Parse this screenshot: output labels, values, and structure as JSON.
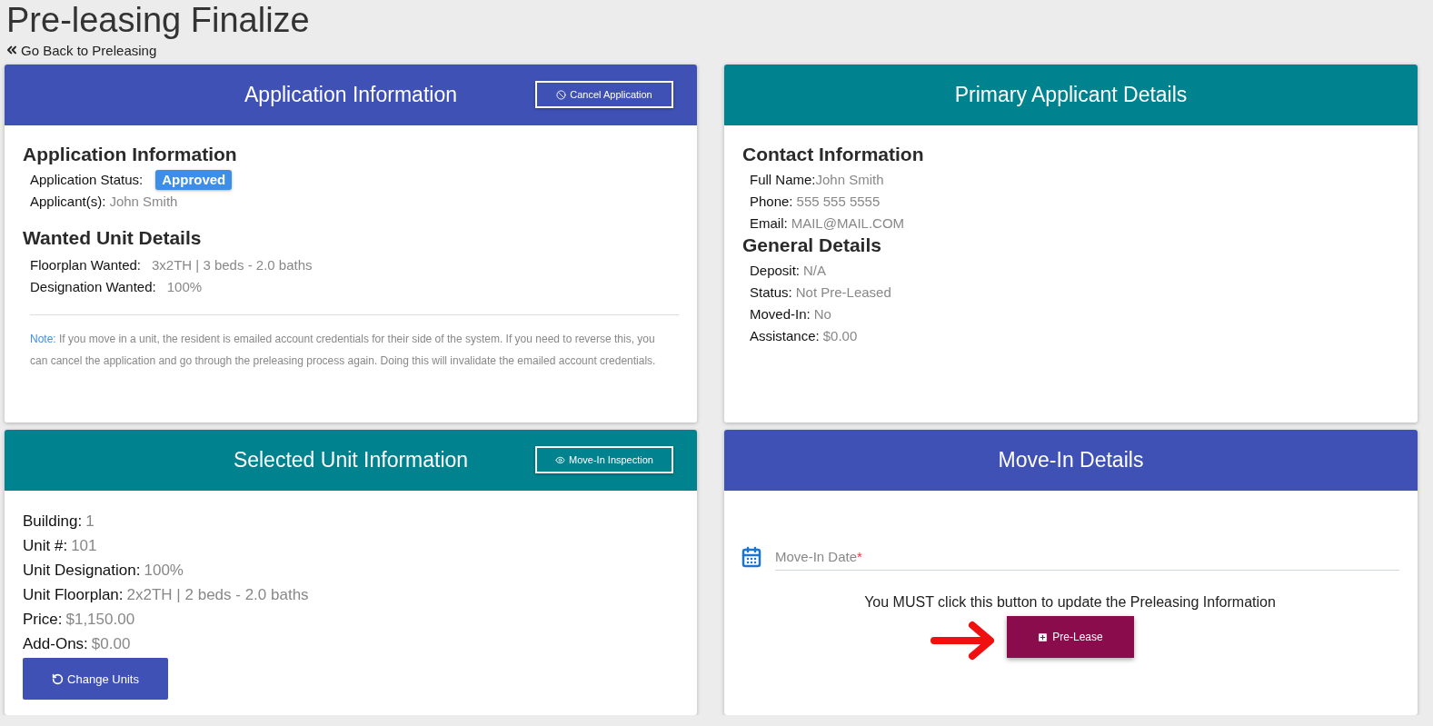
{
  "page": {
    "title": "Pre-leasing Finalize",
    "back_link": "Go Back to Preleasing"
  },
  "application": {
    "header": "Application Information",
    "header_button": "Cancel Application",
    "heading": "Application Information",
    "status_label": "Application Status:",
    "status": "Approved",
    "applicants_label": "Applicant(s):",
    "applicants": "John Smith",
    "wanted_heading": "Wanted Unit Details",
    "wanted": [
      {
        "label": "Floorplan Wanted:",
        "value": "3x2TH | 3 beds - 2.0 baths"
      },
      {
        "label": "Designation Wanted:",
        "value": "100%"
      }
    ],
    "note_label": "Note:",
    "note": "If you move in a unit, the resident is emailed account credentials for their side of the system. If you need to reverse this, you can cancel the application and go through the preleasing process again. Doing this will invalidate the emailed account credentials."
  },
  "applicant": {
    "header": "Primary Applicant Details",
    "sections": [
      {
        "heading": "Contact Information",
        "fields": [
          {
            "label": "Full Name:",
            "value": "John Smith"
          },
          {
            "label": "Phone:",
            "value": "555 555 5555"
          },
          {
            "label": "Email:",
            "value": "MAIL@MAIL.COM"
          }
        ]
      },
      {
        "heading": "General Details",
        "fields": [
          {
            "label": "Deposit:",
            "value": "N/A"
          },
          {
            "label": "Status:",
            "value": "Not Pre-Leased"
          },
          {
            "label": "Moved-In:",
            "value": "No"
          },
          {
            "label": "Assistance:",
            "value": "$0.00"
          }
        ]
      }
    ]
  },
  "unit": {
    "header": "Selected Unit Information",
    "header_button": "Move-In Inspection",
    "fields": [
      {
        "label": "Building:",
        "value": "1"
      },
      {
        "label": "Unit #:",
        "value": "101"
      },
      {
        "label": "Unit Designation:",
        "value": "100%"
      },
      {
        "label": "Unit Floorplan:",
        "value": "2x2TH | 2 beds - 2.0 baths"
      },
      {
        "label": "Price:",
        "value": "$1,150.00"
      },
      {
        "label": "Add-Ons:",
        "value": "$0.00"
      }
    ],
    "button": "Change Units"
  },
  "move_in": {
    "header": "Move-In Details",
    "date_placeholder": "Move-In Date",
    "required_mark": "*",
    "instruction": "You MUST click this button to update the Preleasing Information",
    "button": "Pre-Lease"
  }
}
